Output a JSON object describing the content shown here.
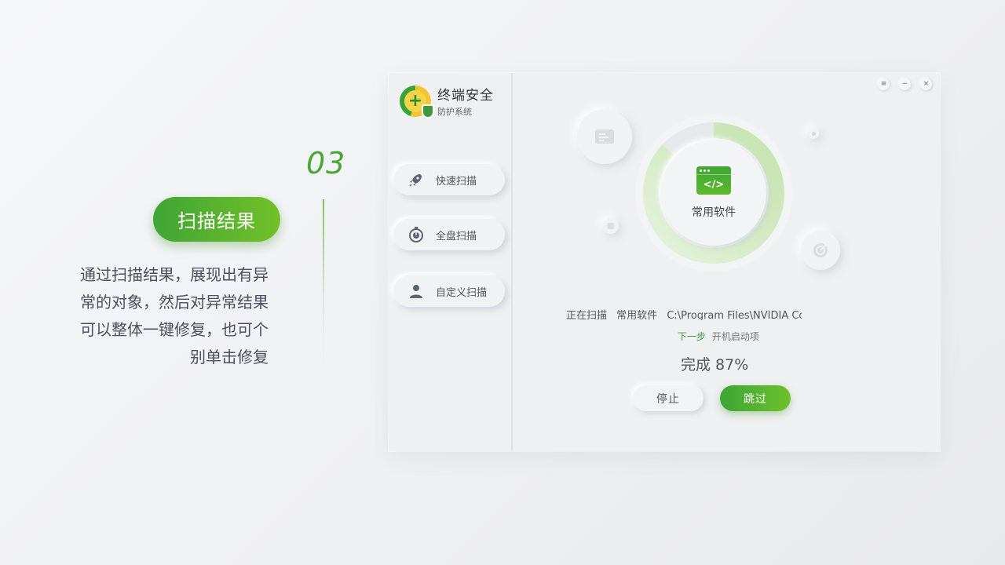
{
  "slide": {
    "step_number": "03",
    "feature_title": "扫描结果",
    "feature_desc": [
      "通过扫描结果，展现出有异",
      "常的对象，然后对异常结果",
      "可以整体一键修复，也可个",
      "别单击修复"
    ]
  },
  "app": {
    "brand_title": "终端安全",
    "brand_subtitle": "防护系统",
    "nav": [
      {
        "label": "快速扫描",
        "icon": "rocket-icon"
      },
      {
        "label": "全盘扫描",
        "icon": "disk-scan-icon"
      },
      {
        "label": "自定义扫描",
        "icon": "user-icon"
      }
    ],
    "window_controls": {
      "menu": "≡",
      "minimize": "−",
      "close": "×"
    },
    "scan": {
      "current_item": "常用软件",
      "progress_percent": 87,
      "status_label": "正在扫描",
      "status_category": "常用软件",
      "status_path": "C:\\Program Files\\NVIDIA Corporation\\D...",
      "next_step_label": "下一步",
      "next_step_item": "开机启动项",
      "complete_text": "完成 87%"
    },
    "buttons": {
      "stop": "停止",
      "skip": "跳过"
    },
    "colors": {
      "accent": "#3fa535",
      "accent_light": "#72c028",
      "ring": "#cfe9c0"
    }
  }
}
